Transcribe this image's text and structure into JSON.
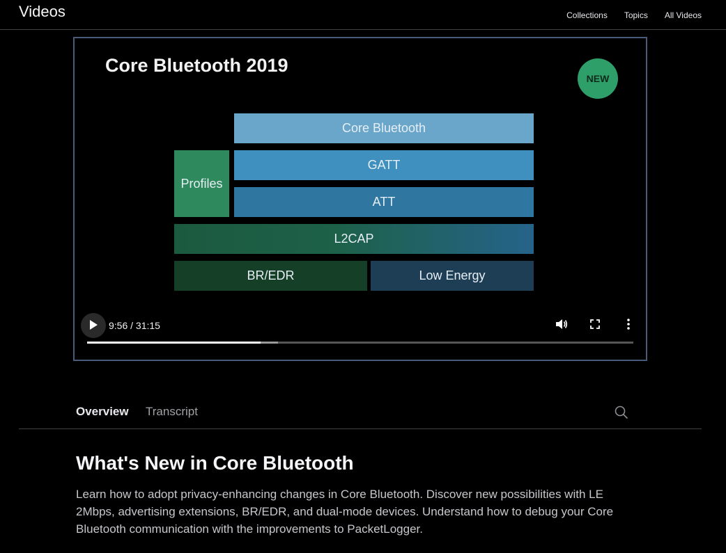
{
  "header": {
    "brand": "Videos",
    "nav": [
      "Collections",
      "Topics",
      "All Videos"
    ]
  },
  "player": {
    "slide": {
      "title": "Core Bluetooth 2019",
      "badge": "NEW",
      "layers": {
        "core_bluetooth": "Core Bluetooth",
        "gatt": "GATT",
        "att": "ATT",
        "profiles": "Profiles",
        "l2cap": "L2CAP",
        "br_edr": "BR/EDR",
        "low_energy": "Low Energy"
      }
    },
    "time_display": "9:56 / 31:15",
    "progress_fraction": 0.318,
    "buffered_fraction": 0.35,
    "icons": [
      "play-icon",
      "volume-icon",
      "fullscreen-icon",
      "more-options-icon"
    ]
  },
  "tabs": {
    "items": [
      "Overview",
      "Transcript"
    ],
    "active": "Overview",
    "search_icon": "search-icon"
  },
  "content": {
    "title": "What's New in Core Bluetooth",
    "description": "Learn how to adopt privacy-enhancing changes in Core Bluetooth. Discover new possibilities with LE 2Mbps, advertising extensions, BR/EDR, and dual-mode devices. Understand how to debug your Core Bluetooth communication with the improvements to PacketLogger."
  },
  "colors": {
    "accent_badge": "#2f9f69",
    "player_border": "#4a5b7a"
  }
}
